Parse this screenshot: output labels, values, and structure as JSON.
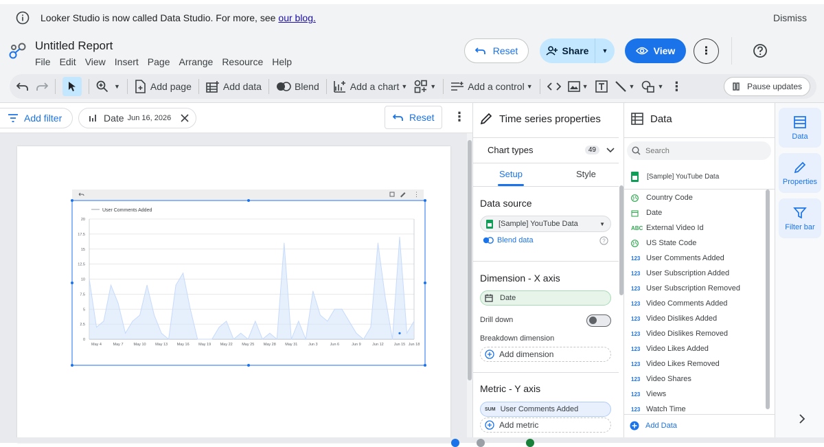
{
  "banner": {
    "message": "Looker Studio is now called Data Studio. For more, see ",
    "link": "our blog.",
    "dismiss": "Dismiss"
  },
  "header": {
    "title": "Untitled Report",
    "menu": [
      "File",
      "Edit",
      "View",
      "Insert",
      "Page",
      "Arrange",
      "Resource",
      "Help"
    ],
    "reset": "Reset",
    "share": "Share",
    "view": "View"
  },
  "toolbar": {
    "add_page": "Add page",
    "add_data": "Add data",
    "blend": "Blend",
    "add_chart": "Add a chart",
    "add_control": "Add a control",
    "pause": "Pause updates"
  },
  "filterbar": {
    "add_filter": "Add filter",
    "date_label": "Date",
    "date_value": "Jun 16, 2026",
    "reset": "Reset"
  },
  "chart": {
    "legend": "User Comments Added",
    "xticks": [
      "May 4",
      "May 7",
      "May 10",
      "May 13",
      "May 16",
      "May 19",
      "May 22",
      "May 25",
      "May 28",
      "May 31",
      "Jun 3",
      "Jun 6",
      "Jun 9",
      "Jun 12",
      "Jun 15",
      "Jun 18"
    ],
    "yticks": [
      "0",
      "2.5",
      "5",
      "7.5",
      "10",
      "12.5",
      "15",
      "17.5",
      "20"
    ]
  },
  "chart_data": {
    "type": "area",
    "xlabel": "",
    "ylabel": "",
    "ylim": [
      0,
      20
    ],
    "x": [
      "May 3",
      "May 4",
      "May 5",
      "May 6",
      "May 7",
      "May 8",
      "May 9",
      "May 10",
      "May 11",
      "May 12",
      "May 13",
      "May 14",
      "May 15",
      "May 16",
      "May 17",
      "May 18",
      "May 19",
      "May 20",
      "May 21",
      "May 22",
      "May 23",
      "May 24",
      "May 25",
      "May 26",
      "May 27",
      "May 28",
      "May 29",
      "May 30",
      "May 31",
      "Jun 1",
      "Jun 2",
      "Jun 3",
      "Jun 4",
      "Jun 5",
      "Jun 6",
      "Jun 7",
      "Jun 8",
      "Jun 9",
      "Jun 10",
      "Jun 11",
      "Jun 12",
      "Jun 13",
      "Jun 14",
      "Jun 15",
      "Jun 16",
      "Jun 17"
    ],
    "series": [
      {
        "name": "User Comments Added",
        "values": [
          10,
          2,
          3,
          9,
          6,
          1,
          3,
          4,
          9,
          4,
          1,
          0,
          9,
          11,
          5,
          0,
          0,
          0,
          2,
          3,
          0,
          1,
          0,
          3,
          0,
          1,
          0,
          16,
          0,
          3,
          0,
          8,
          4,
          3,
          5,
          5,
          3,
          1,
          0,
          2,
          16,
          7,
          0,
          17,
          1,
          3
        ]
      }
    ],
    "grid": true,
    "legend_position": "top-left"
  },
  "props": {
    "header": "Time series properties",
    "chart_types": "Chart types",
    "chart_types_count": "49",
    "tab_setup": "Setup",
    "tab_style": "Style",
    "data_source": "Data source",
    "source_name": "[Sample] YouTube Data",
    "blend_data": "Blend data",
    "dimension": "Dimension - X axis",
    "dim_field": "Date",
    "drill_down": "Drill down",
    "breakdown": "Breakdown dimension",
    "add_dimension": "Add dimension",
    "metric": "Metric - Y axis",
    "metric_agg": "SUM",
    "metric_field": "User Comments Added",
    "add_metric": "Add metric"
  },
  "datapanel": {
    "header": "Data",
    "search_placeholder": "Search",
    "source": "[Sample] YouTube Data",
    "fields": [
      {
        "type": "geo",
        "name": "Country Code"
      },
      {
        "type": "date",
        "name": "Date"
      },
      {
        "type": "ABC",
        "name": "External Video Id"
      },
      {
        "type": "geo",
        "name": "US State Code"
      },
      {
        "type": "123",
        "name": "User Comments Added"
      },
      {
        "type": "123",
        "name": "User Subscription Added"
      },
      {
        "type": "123",
        "name": "User Subscription Removed"
      },
      {
        "type": "123",
        "name": "Video Comments Added"
      },
      {
        "type": "123",
        "name": "Video Dislikes Added"
      },
      {
        "type": "123",
        "name": "Video Dislikes Removed"
      },
      {
        "type": "123",
        "name": "Video Likes Added"
      },
      {
        "type": "123",
        "name": "Video Likes Removed"
      },
      {
        "type": "123",
        "name": "Video Shares"
      },
      {
        "type": "123",
        "name": "Views"
      },
      {
        "type": "123",
        "name": "Watch Time"
      }
    ],
    "add_data": "Add Data"
  },
  "rail": {
    "data": "Data",
    "properties": "Properties",
    "filter_bar": "Filter bar"
  },
  "colors": {
    "accent": "#1a73e8",
    "share_bg": "#c2e7ff",
    "dim_green": "#e6f4ea",
    "metric_blue": "#e8f0fe"
  }
}
